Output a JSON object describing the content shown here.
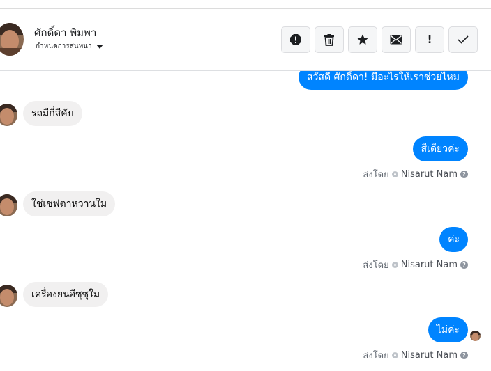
{
  "header": {
    "name": "ศักดิ์ดา พิมพา",
    "subtitle": "กำหนดการสนทนา"
  },
  "actions": [
    {
      "name": "alert-button",
      "icon": "exclamation-circle-icon"
    },
    {
      "name": "delete-button",
      "icon": "trash-icon"
    },
    {
      "name": "star-button",
      "icon": "star-icon"
    },
    {
      "name": "mark-unread-button",
      "icon": "envelope-icon"
    },
    {
      "name": "spam-button",
      "icon": "exclamation-icon",
      "glyph": "!"
    },
    {
      "name": "done-button",
      "icon": "check-icon"
    }
  ],
  "messages": [
    {
      "direction": "out",
      "text": "สวัสดี ศักดิ์ดา! มีอะไรให้เราช่วยไหม"
    },
    {
      "direction": "in",
      "text": "รถมีกี่สีคับ"
    },
    {
      "direction": "out",
      "text": "สีเดียวค่ะ",
      "sent_by_label": "ส่งโดย",
      "sender": "Nisarut Nam"
    },
    {
      "direction": "in",
      "text": "ใช่เชฟตาหวานใม"
    },
    {
      "direction": "out",
      "text": "ค่ะ",
      "sent_by_label": "ส่งโดย",
      "sender": "Nisarut Nam"
    },
    {
      "direction": "in",
      "text": "เครื่องยนอีซุซุใม"
    },
    {
      "direction": "out",
      "text": "ไม่ค่ะ",
      "sent_by_label": "ส่งโดย",
      "sender": "Nisarut Nam",
      "seen": true
    }
  ],
  "colors": {
    "outgoing_bubble": "#0084ff",
    "incoming_bubble": "#f1f0f0"
  }
}
